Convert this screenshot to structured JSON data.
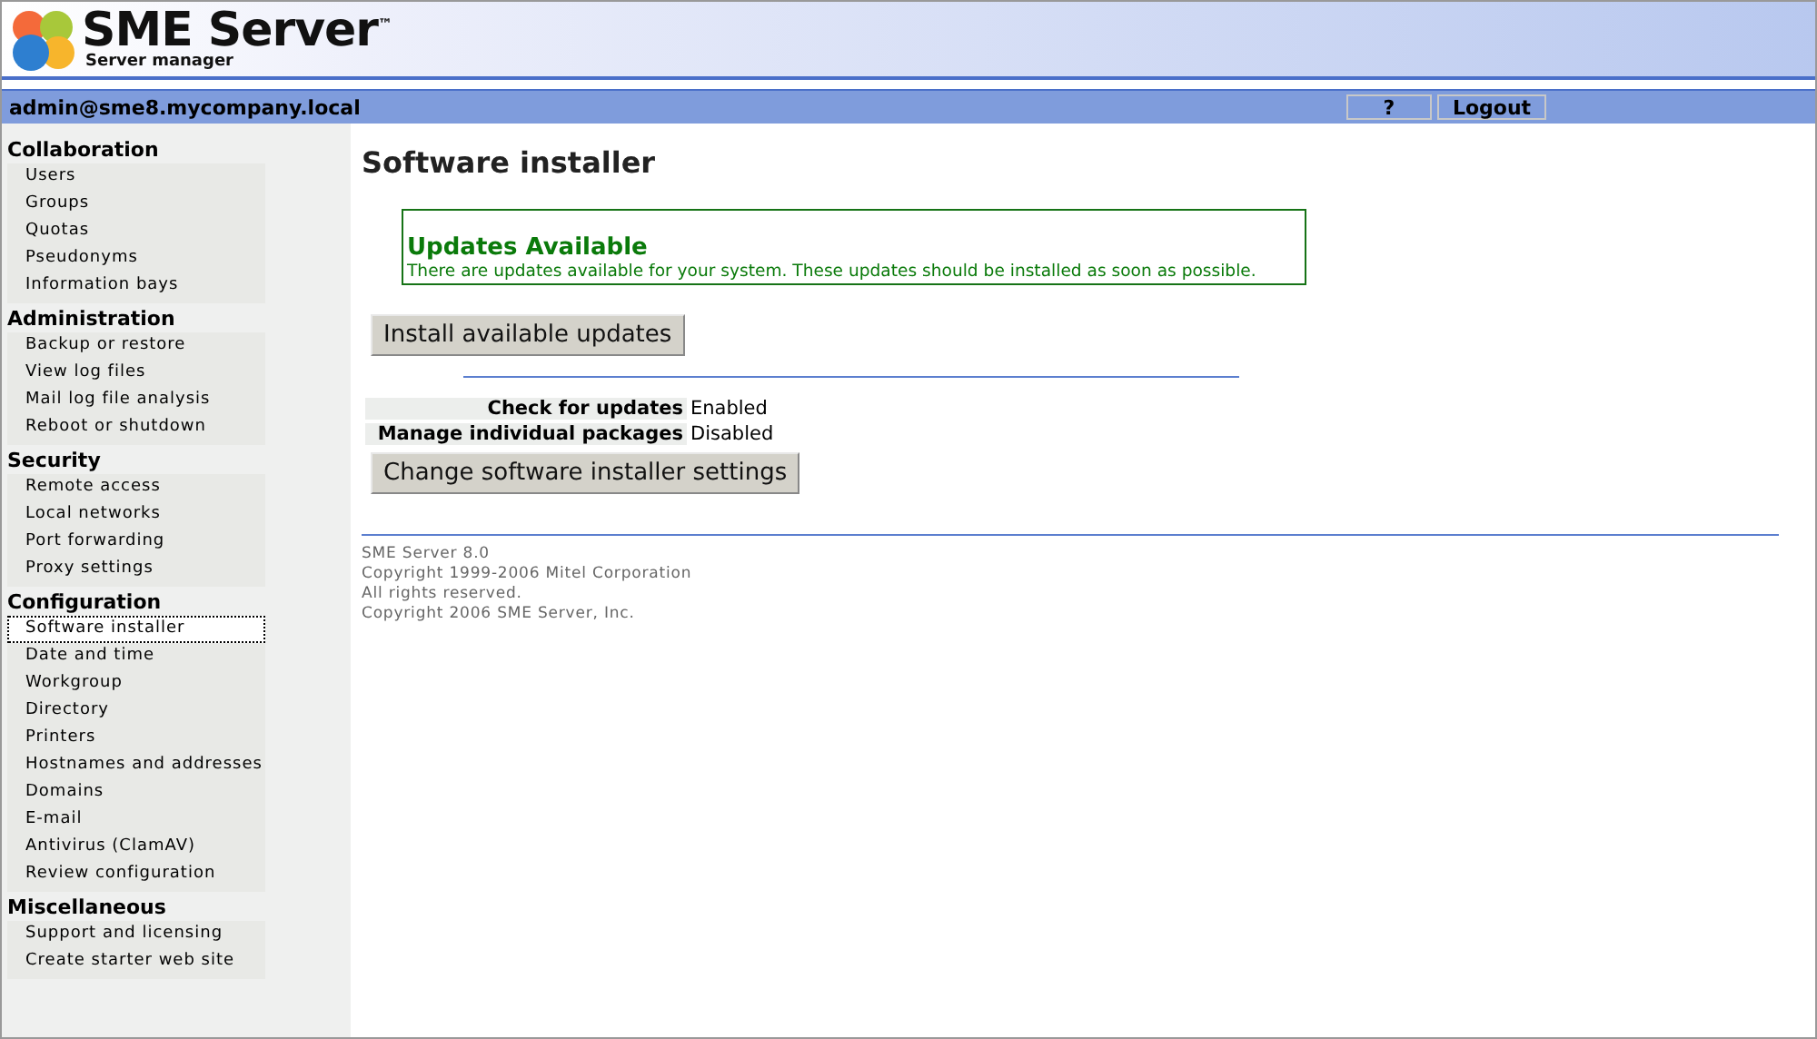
{
  "header": {
    "title": "SME Server",
    "trademark": "™",
    "subtitle": "Server manager"
  },
  "user_bar": {
    "user": "admin@sme8.mycompany.local",
    "buttons": [
      "?",
      "Logout"
    ]
  },
  "sidebar": {
    "groups": [
      {
        "heading": "Collaboration",
        "items": [
          {
            "label": "Users",
            "selected": false
          },
          {
            "label": "Groups",
            "selected": false
          },
          {
            "label": "Quotas",
            "selected": false
          },
          {
            "label": "Pseudonyms",
            "selected": false
          },
          {
            "label": "Information bays",
            "selected": false
          }
        ]
      },
      {
        "heading": "Administration",
        "items": [
          {
            "label": "Backup or restore",
            "selected": false
          },
          {
            "label": "View log files",
            "selected": false
          },
          {
            "label": "Mail log file analysis",
            "selected": false
          },
          {
            "label": "Reboot or shutdown",
            "selected": false
          }
        ]
      },
      {
        "heading": "Security",
        "items": [
          {
            "label": "Remote access",
            "selected": false
          },
          {
            "label": "Local networks",
            "selected": false
          },
          {
            "label": "Port forwarding",
            "selected": false
          },
          {
            "label": "Proxy settings",
            "selected": false
          }
        ]
      },
      {
        "heading": "Configuration",
        "items": [
          {
            "label": "Software installer",
            "selected": true
          },
          {
            "label": "Date and time",
            "selected": false
          },
          {
            "label": "Workgroup",
            "selected": false
          },
          {
            "label": "Directory",
            "selected": false
          },
          {
            "label": "Printers",
            "selected": false
          },
          {
            "label": "Hostnames and addresses",
            "selected": false
          },
          {
            "label": "Domains",
            "selected": false
          },
          {
            "label": "E-mail",
            "selected": false
          },
          {
            "label": "Antivirus (ClamAV)",
            "selected": false
          },
          {
            "label": "Review configuration",
            "selected": false
          }
        ]
      },
      {
        "heading": "Miscellaneous",
        "items": [
          {
            "label": "Support and licensing",
            "selected": false
          },
          {
            "label": "Create starter web site",
            "selected": false
          }
        ]
      }
    ]
  },
  "page": {
    "title": "Software installer",
    "notice": {
      "title": "Updates Available",
      "text": "There are updates available for your system. These updates should be installed as soon as possible."
    },
    "install_button": "Install available updates",
    "settings": [
      {
        "label": "Check for updates",
        "value": "Enabled"
      },
      {
        "label": "Manage individual packages",
        "value": "Disabled"
      }
    ],
    "settings_button": "Change software installer settings",
    "footer": [
      "SME Server 8.0",
      "Copyright 1999-2006 Mitel Corporation",
      "All rights reserved.",
      "Copyright 2006 SME Server, Inc."
    ]
  }
}
